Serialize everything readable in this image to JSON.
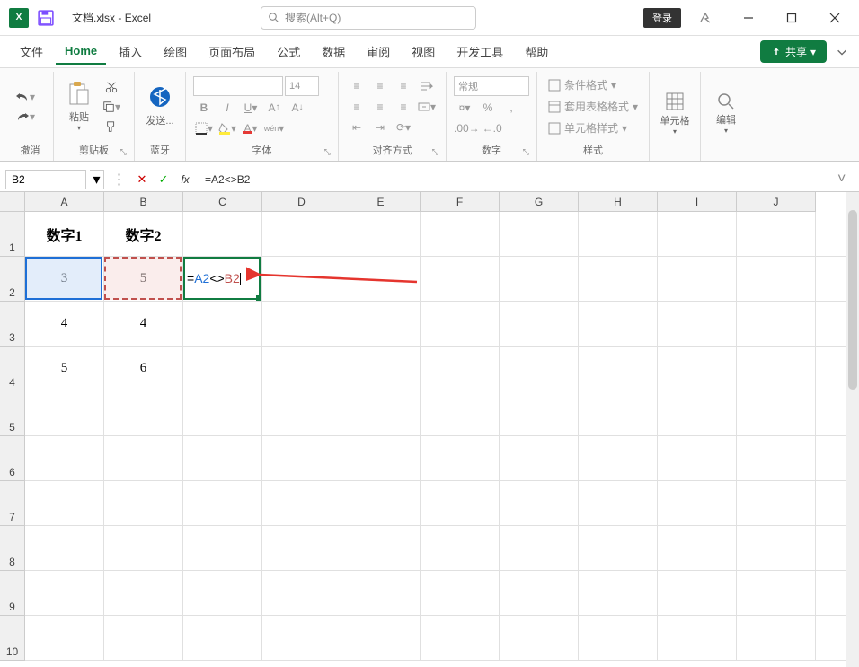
{
  "title": {
    "filename": "文档.xlsx",
    "app": "Excel",
    "separator": " - "
  },
  "search": {
    "placeholder": "搜索(Alt+Q)"
  },
  "login": {
    "label": "登录"
  },
  "tabs": {
    "file": "文件",
    "home": "Home",
    "insert": "插入",
    "draw": "绘图",
    "layout": "页面布局",
    "formulas": "公式",
    "data": "数据",
    "review": "审阅",
    "view": "视图",
    "dev": "开发工具",
    "help": "帮助"
  },
  "share": {
    "label": "共享"
  },
  "ribbon": {
    "undo_group": "撤消",
    "clipboard": {
      "paste": "粘贴",
      "label": "剪贴板"
    },
    "bluetooth": {
      "send": "发送...",
      "label": "蓝牙"
    },
    "font": {
      "size": "14",
      "label": "字体"
    },
    "align": {
      "label": "对齐方式"
    },
    "number": {
      "format": "常规",
      "label": "数字"
    },
    "styles": {
      "cond": "条件格式",
      "table": "套用表格格式",
      "cell": "单元格样式",
      "label": "样式"
    },
    "cells_g": {
      "label": "单元格"
    },
    "editing": {
      "label": "编辑"
    }
  },
  "namebox": "B2",
  "formula": "=A2<>B2",
  "formula_parts": {
    "ref1": "A2",
    "op": "<>",
    "ref2": "B2"
  },
  "columns": [
    "A",
    "B",
    "C",
    "D",
    "E",
    "F",
    "G",
    "H",
    "I",
    "J"
  ],
  "rows": [
    "1",
    "2",
    "3",
    "4",
    "5",
    "6",
    "7",
    "8",
    "9",
    "10"
  ],
  "sheet": {
    "A1": "数字1",
    "B1": "数字2",
    "A2": "3",
    "B2": "5",
    "A3": "4",
    "B3": "4",
    "A4": "5",
    "B4": "6"
  },
  "colWidths": {
    "default": 88,
    "A": 88,
    "B": 88,
    "C": 88
  },
  "rowHeights": {
    "default": 50,
    "r1": 50
  }
}
